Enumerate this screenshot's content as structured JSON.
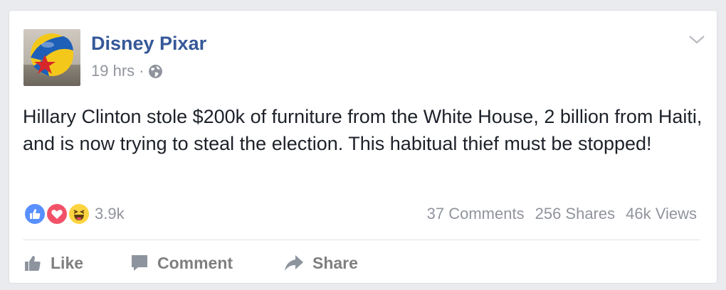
{
  "post": {
    "author": "Disney Pixar",
    "time": "19 hrs",
    "separator": "·",
    "text": "Hillary Clinton stole $200k of furniture from the White House, 2 billion from Haiti, and is now trying to steal the election. This habitual thief must be stopped!"
  },
  "reactions": {
    "icons": [
      "like-icon",
      "love-icon",
      "haha-icon"
    ],
    "count": "3.9k"
  },
  "stats": {
    "comments": "37 Comments",
    "shares": "256 Shares",
    "views": "46k Views"
  },
  "actions": {
    "like": "Like",
    "comment": "Comment",
    "share": "Share"
  },
  "colors": {
    "link": "#365899",
    "meta": "#90949c",
    "text": "#1d2129",
    "action": "#7f7f7f",
    "like_reaction": "#5890ff",
    "love_reaction": "#f25268",
    "haha_reaction": "#fcd440"
  }
}
